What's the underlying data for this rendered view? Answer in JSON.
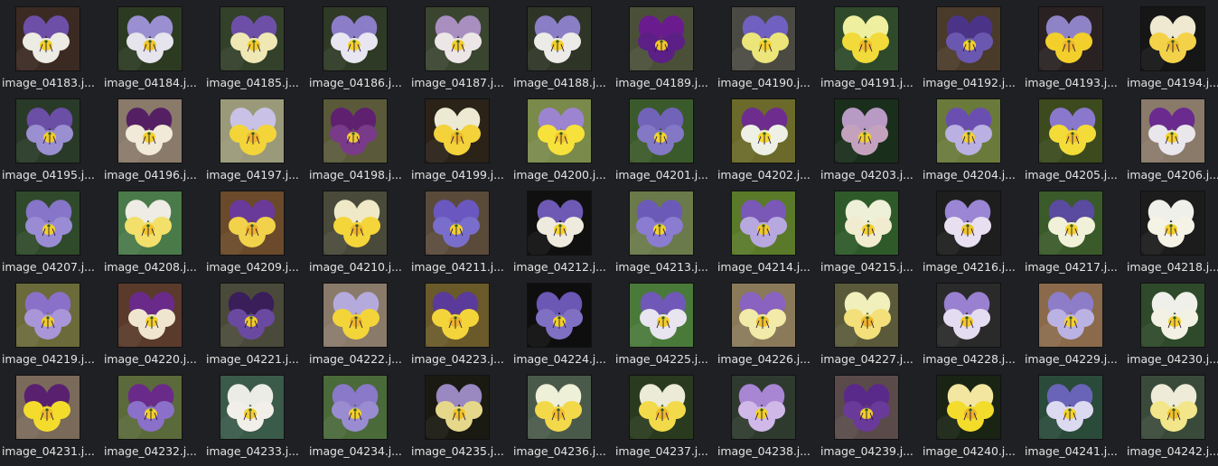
{
  "theme": {
    "background": "#1f2023",
    "label_color": "#e2e2e2"
  },
  "files": [
    {
      "label": "image_04183.j...",
      "bg": "#3b2a22",
      "upper": "#6d4fa8",
      "lower": "#ecebe4",
      "center": "#f2cf2a"
    },
    {
      "label": "image_04184.j...",
      "bg": "#2c3a22",
      "upper": "#9a8fd0",
      "lower": "#e6e4ec",
      "center": "#f0c72a"
    },
    {
      "label": "image_04185.j...",
      "bg": "#33402a",
      "upper": "#6d4fa8",
      "lower": "#efe7b4",
      "center": "#f1cc27"
    },
    {
      "label": "image_04186.j...",
      "bg": "#2f3a26",
      "upper": "#8c7dc8",
      "lower": "#e8e6f0",
      "center": "#f2d030"
    },
    {
      "label": "image_04187.j...",
      "bg": "#3a4530",
      "upper": "#a88fc0",
      "lower": "#ece6e6",
      "center": "#f1cd2d"
    },
    {
      "label": "image_04188.j...",
      "bg": "#2e3526",
      "upper": "#8a7ec6",
      "lower": "#ecebe7",
      "center": "#f3d02c"
    },
    {
      "label": "image_04189.j...",
      "bg": "#4a5038",
      "upper": "#6a1c8e",
      "lower": "#5b1f86",
      "center": "#f2c52c"
    },
    {
      "label": "image_04190.j...",
      "bg": "#4a4a42",
      "upper": "#7060c0",
      "lower": "#ece57a",
      "center": "#f3d02a"
    },
    {
      "label": "image_04191.j...",
      "bg": "#2e4a2a",
      "upper": "#eef0a0",
      "lower": "#f2da3a",
      "center": "#f0b92a"
    },
    {
      "label": "image_04192.j...",
      "bg": "#4a3a2a",
      "upper": "#4b3488",
      "lower": "#6a58b0",
      "center": "#f1cf30"
    },
    {
      "label": "image_04193.j...",
      "bg": "#2a2222",
      "upper": "#8f83c8",
      "lower": "#f3cf2b",
      "center": "#efb62a"
    },
    {
      "label": "image_04194.j...",
      "bg": "#161616",
      "upper": "#efe9d2",
      "lower": "#f3d24a",
      "center": "#eabb2c"
    },
    {
      "label": "image_04195.j...",
      "bg": "#2a3a28",
      "upper": "#6b4ea6",
      "lower": "#9a8fd0",
      "center": "#f0cb2a"
    },
    {
      "label": "image_04196.j...",
      "bg": "#8a7a6a",
      "upper": "#542063",
      "lower": "#f1ead8",
      "center": "#f3cf2d"
    },
    {
      "label": "image_04197.j...",
      "bg": "#9a9a7a",
      "upper": "#c9c2e6",
      "lower": "#f3d53a",
      "center": "#efb42a"
    },
    {
      "label": "image_04198.j...",
      "bg": "#5a5a3a",
      "upper": "#5f2070",
      "lower": "#7a3a8a",
      "center": "#f0c93a"
    },
    {
      "label": "image_04199.j...",
      "bg": "#2b2218",
      "upper": "#ecead2",
      "lower": "#f3d23a",
      "center": "#eeb82a"
    },
    {
      "label": "image_04200.j...",
      "bg": "#7a8a4a",
      "upper": "#9d84d0",
      "lower": "#f6e23a",
      "center": "#f0c52a"
    },
    {
      "label": "image_04201.j...",
      "bg": "#3b5a2b",
      "upper": "#7063b8",
      "lower": "#8378c6",
      "center": "#f2d42c"
    },
    {
      "label": "image_04202.j...",
      "bg": "#6b6a2a",
      "upper": "#6e2c8e",
      "lower": "#eef0e6",
      "center": "#f3d62c"
    },
    {
      "label": "image_04203.j...",
      "bg": "#1a2e1c",
      "upper": "#b89ac4",
      "lower": "#c4a2be",
      "center": "#f1cf2c"
    },
    {
      "label": "image_04204.j...",
      "bg": "#6a7a3a",
      "upper": "#6a4fb0",
      "lower": "#bab0e2",
      "center": "#f2d030"
    },
    {
      "label": "image_04205.j...",
      "bg": "#3c4a1e",
      "upper": "#8a78cc",
      "lower": "#f4dc38",
      "center": "#efbd2a"
    },
    {
      "label": "image_04206.j...",
      "bg": "#8a7a6a",
      "upper": "#6a2a8e",
      "lower": "#e9e6ec",
      "center": "#f3d02c"
    },
    {
      "label": "image_04207.j...",
      "bg": "#2f4a2a",
      "upper": "#8675c8",
      "lower": "#9a8cd4",
      "center": "#f2d02c"
    },
    {
      "label": "image_04208.j...",
      "bg": "#4a7a4a",
      "upper": "#eeece4",
      "lower": "#f2e06a",
      "center": "#efc22a"
    },
    {
      "label": "image_04209.j...",
      "bg": "#6a4a2a",
      "upper": "#6a3a9a",
      "lower": "#f1d24a",
      "center": "#edb12a"
    },
    {
      "label": "image_04210.j...",
      "bg": "#4a4a3a",
      "upper": "#efe9c8",
      "lower": "#f4d63a",
      "center": "#eeb52a"
    },
    {
      "label": "image_04211.j...",
      "bg": "#5a4a3a",
      "upper": "#6a58c0",
      "lower": "#7a6ecc",
      "center": "#f2d02a"
    },
    {
      "label": "image_04212.j...",
      "bg": "#101010",
      "upper": "#6e5ab4",
      "lower": "#eeeade",
      "center": "#f3d22c"
    },
    {
      "label": "image_04213.j...",
      "bg": "#6a7a4a",
      "upper": "#6c5ab8",
      "lower": "#8a7cd0",
      "center": "#f2d22c"
    },
    {
      "label": "image_04214.j...",
      "bg": "#5a7a2a",
      "upper": "#7a58b8",
      "lower": "#b8a8e0",
      "center": "#f0c82a"
    },
    {
      "label": "image_04215.j...",
      "bg": "#2e5a2a",
      "upper": "#eef0d8",
      "lower": "#f1ecd0",
      "center": "#f3cf2a"
    },
    {
      "label": "image_04216.j...",
      "bg": "#1e1e1e",
      "upper": "#9a86d4",
      "lower": "#e8e0f0",
      "center": "#f0c72a"
    },
    {
      "label": "image_04217.j...",
      "bg": "#3a5a2a",
      "upper": "#5a4aa0",
      "lower": "#f1f0d8",
      "center": "#f3d12c"
    },
    {
      "label": "image_04218.j...",
      "bg": "#1c1c1c",
      "upper": "#f0f0ea",
      "lower": "#f5f3e6",
      "center": "#f2cf2a"
    },
    {
      "label": "image_04219.j...",
      "bg": "#6a6a3a",
      "upper": "#8a70c8",
      "lower": "#a896d8",
      "center": "#f1cc2c"
    },
    {
      "label": "image_04220.j...",
      "bg": "#5a3a2a",
      "upper": "#6a2a8a",
      "lower": "#f0e6d0",
      "center": "#f3d02a"
    },
    {
      "label": "image_04221.j...",
      "bg": "#4a4a3a",
      "upper": "#3a1e5a",
      "lower": "#6a4aa0",
      "center": "#f0ca2c"
    },
    {
      "label": "image_04222.j...",
      "bg": "#8a7a6a",
      "upper": "#b4aadc",
      "lower": "#f3d53a",
      "center": "#efb82a"
    },
    {
      "label": "image_04223.j...",
      "bg": "#6a5a2a",
      "upper": "#5a3a9a",
      "lower": "#f3d43a",
      "center": "#edb42a"
    },
    {
      "label": "image_04224.j...",
      "bg": "#0e0e0e",
      "upper": "#6a58b4",
      "lower": "#8070c4",
      "center": "#f2d02a"
    },
    {
      "label": "image_04225.j...",
      "bg": "#4a7a3a",
      "upper": "#7058b8",
      "lower": "#e8e4f0",
      "center": "#f2cf2c"
    },
    {
      "label": "image_04226.j...",
      "bg": "#8a7a5a",
      "upper": "#8a62c0",
      "lower": "#f1eaa8",
      "center": "#f0c22a"
    },
    {
      "label": "image_04227.j...",
      "bg": "#5a5a3a",
      "upper": "#f1f0bc",
      "lower": "#f3e07a",
      "center": "#eeb42a"
    },
    {
      "label": "image_04228.j...",
      "bg": "#2a2a2a",
      "upper": "#9a80d0",
      "lower": "#e4dcf0",
      "center": "#f1c92a"
    },
    {
      "label": "image_04229.j...",
      "bg": "#8a6a4a",
      "upper": "#8d7cc8",
      "lower": "#bab2e2",
      "center": "#f2d02c"
    },
    {
      "label": "image_04230.j...",
      "bg": "#2e4a2a",
      "upper": "#f0f0ea",
      "lower": "#f3f1e4",
      "center": "#f2cf2a"
    },
    {
      "label": "image_04231.j...",
      "bg": "#7a6a5a",
      "upper": "#5a2070",
      "lower": "#f4dc2c",
      "center": "#f0bc2a"
    },
    {
      "label": "image_04232.j...",
      "bg": "#5a6a3a",
      "upper": "#6a2a8a",
      "lower": "#8a70c8",
      "center": "#f2d02c"
    },
    {
      "label": "image_04233.j...",
      "bg": "#3a5a4a",
      "upper": "#ecece6",
      "lower": "#f1efe8",
      "center": "#f3d030"
    },
    {
      "label": "image_04234.j...",
      "bg": "#4a6a3a",
      "upper": "#8a78c8",
      "lower": "#9a8cd0",
      "center": "#f1cf2a"
    },
    {
      "label": "image_04235.j...",
      "bg": "#1a1a12",
      "upper": "#9a88c0",
      "lower": "#e6d88a",
      "center": "#f0c22a"
    },
    {
      "label": "image_04236.j...",
      "bg": "#4a5a4a",
      "upper": "#eef0d8",
      "lower": "#f3d84a",
      "center": "#efbc2a"
    },
    {
      "label": "image_04237.j...",
      "bg": "#2a3a1e",
      "upper": "#ecebd8",
      "lower": "#f2da4a",
      "center": "#eeb82a"
    },
    {
      "label": "image_04238.j...",
      "bg": "#2e3a2e",
      "upper": "#a886d4",
      "lower": "#d0b8e8",
      "center": "#f2d02c"
    },
    {
      "label": "image_04239.j...",
      "bg": "#5a4a4a",
      "upper": "#5a2a8a",
      "lower": "#6a3a9a",
      "center": "#f1cc2c"
    },
    {
      "label": "image_04240.j...",
      "bg": "#1a2414",
      "upper": "#f2e6a0",
      "lower": "#f3dc2c",
      "center": "#edb42a"
    },
    {
      "label": "image_04241.j...",
      "bg": "#2a4a3a",
      "upper": "#6a64b8",
      "lower": "#dcdaf0",
      "center": "#f2d22c"
    },
    {
      "label": "image_04242.j...",
      "bg": "#3a4a3a",
      "upper": "#eeecd8",
      "lower": "#f3e68a",
      "center": "#f0c22a"
    }
  ]
}
